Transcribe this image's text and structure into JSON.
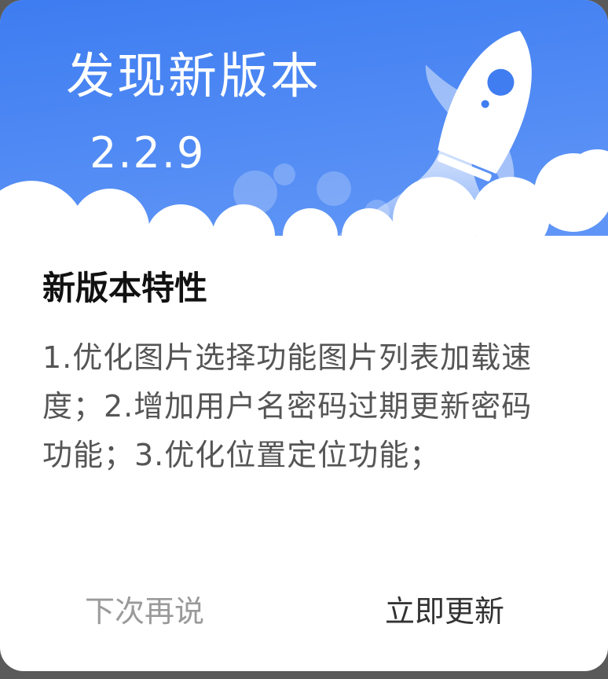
{
  "dialog": {
    "title": "发现新版本",
    "version": "2.2.9",
    "section_heading": "新版本特性",
    "release_notes": "1.优化图片选择功能图片列表加载速度；2.增加用户名密码过期更新密码功能；3.优化位置定位功能；",
    "later_button_label": "下次再说",
    "update_button_label": "立即更新"
  },
  "banner": {
    "icon": "rocket-icon",
    "colors": {
      "gradient_top": "#3d7cf1",
      "gradient_bottom": "#5f95f6",
      "cloud": "#ffffff"
    }
  }
}
